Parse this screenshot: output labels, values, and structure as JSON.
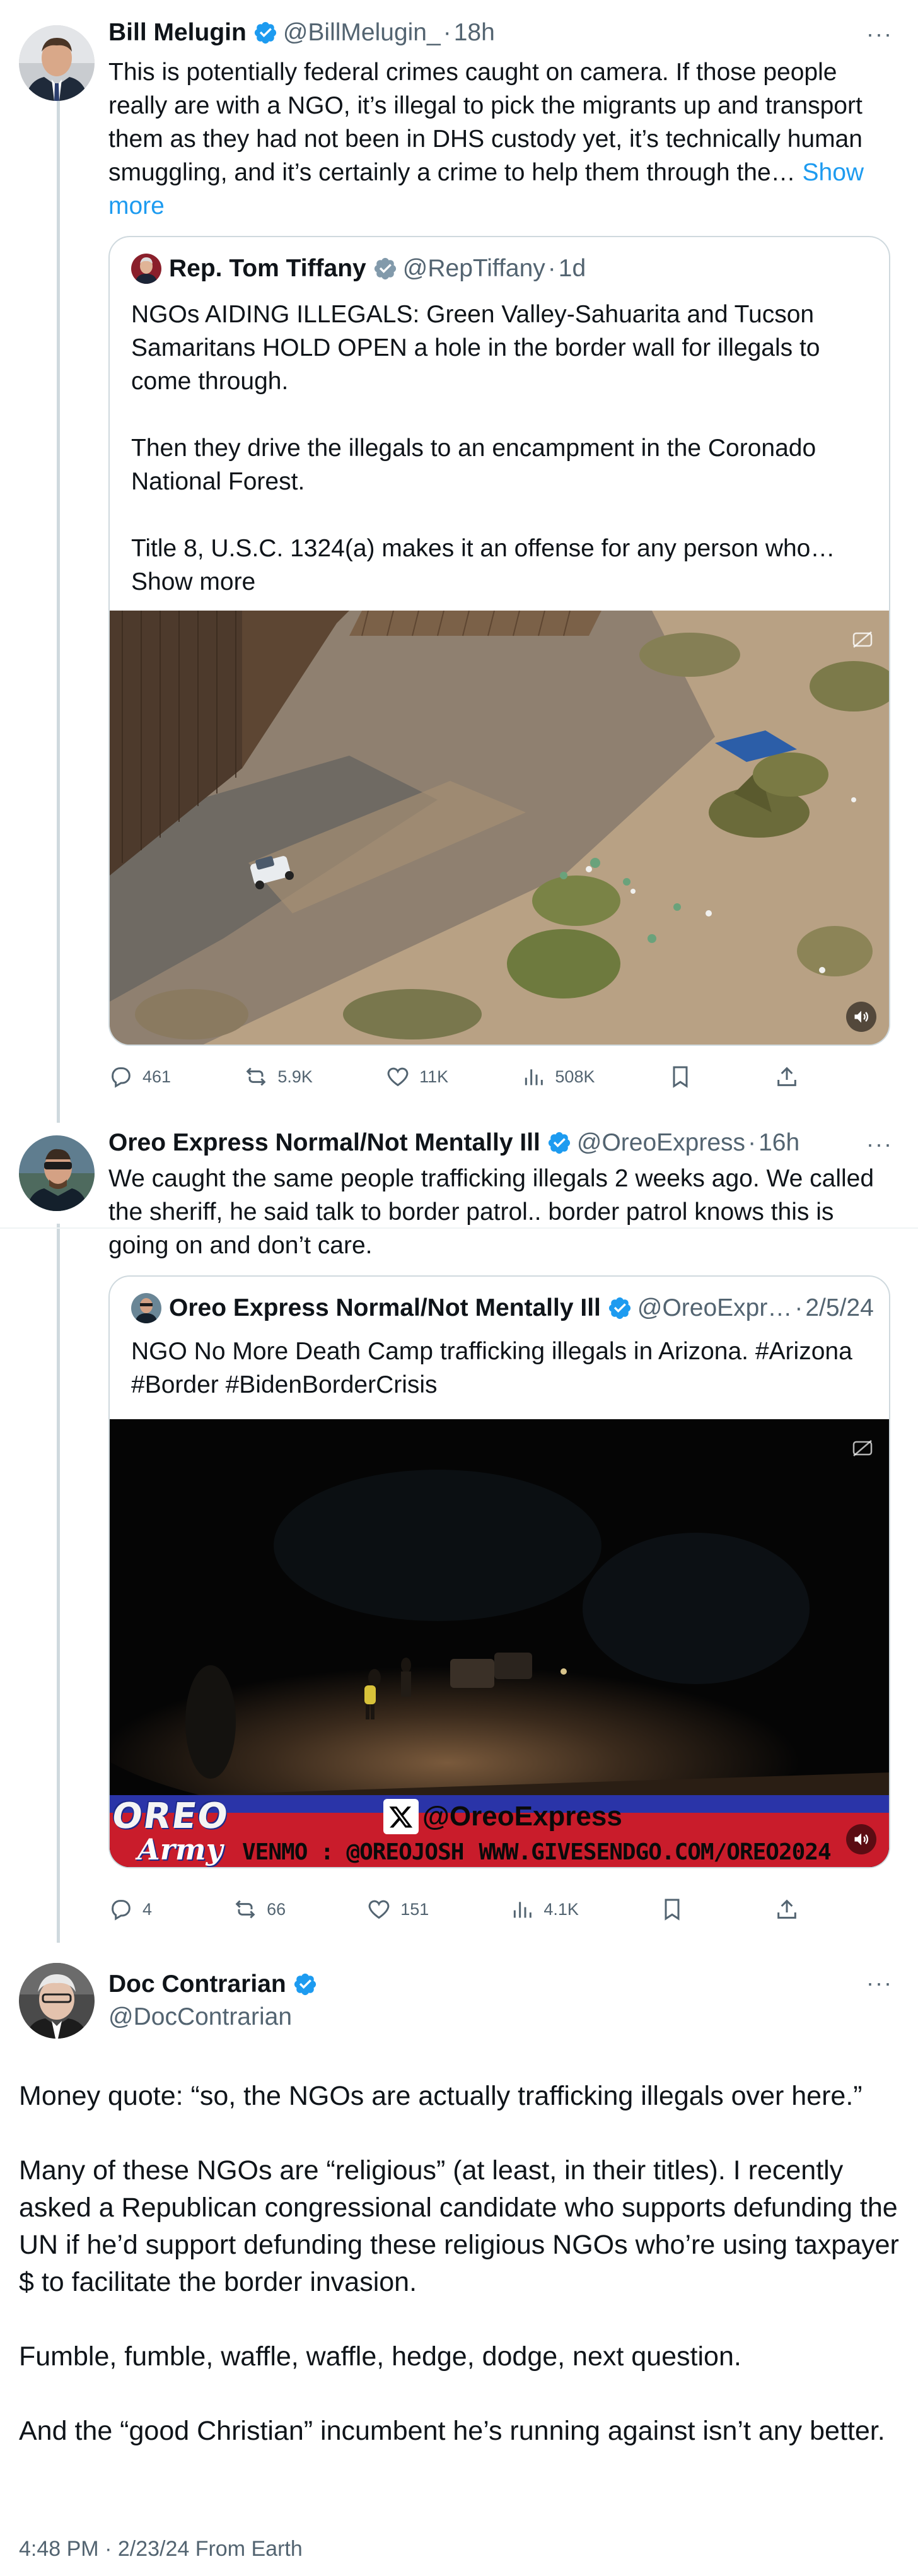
{
  "posts": [
    {
      "author": {
        "name": "Bill Melugin",
        "handle": "@BillMelugin_",
        "time": "18h"
      },
      "text": "This is potentially federal crimes caught on camera. If those people really are with a NGO, it’s illegal to pick the migrants up and transport them as they had not been in DHS custody yet, it’s technically human smuggling, and it’s certainly a crime to help them through the…",
      "show_more": "Show more",
      "quote": {
        "author": {
          "name": "Rep. Tom Tiffany",
          "handle": "@RepTiffany",
          "time": "1d"
        },
        "paragraphs": [
          "NGOs AIDING ILLEGALS: Green Valley-Sahuarita and Tucson Samaritans HOLD OPEN a hole in the border wall for illegals to come through.",
          "Then they drive the illegals to an encampment in the Coronado National Forest.",
          "Title 8, U.S.C. 1324(a) makes it an offense for any person who… Show more"
        ]
      },
      "actions": {
        "replies": "461",
        "reposts": "5.9K",
        "likes": "11K",
        "views": "508K"
      }
    },
    {
      "author": {
        "name": "Oreo Express Normal/Not Mentally Ill",
        "handle": "@OreoExpress",
        "time": "16h"
      },
      "text": "We caught the same people trafficking illegals 2 weeks ago. We called the sheriff, he said talk to border patrol.. border patrol knows this is going on and don’t care.",
      "quote": {
        "author": {
          "name": "Oreo Express Normal/Not Mentally Ill",
          "handle": "@OreoExpr…",
          "time": "2/5/24"
        },
        "text": "NGO No More Death Camp trafficking illegals in Arizona. #Arizona #Border #BidenBorderCrisis",
        "banner": {
          "logo_top": "OREO",
          "logo_bottom": "Army",
          "x_handle": "@OreoExpress",
          "venmo": "VENMO : @OREOJOSH",
          "url": "WWW.GIVESENDGO.COM/OREO2024"
        }
      },
      "actions": {
        "replies": "4",
        "reposts": "66",
        "likes": "151",
        "views": "4.1K"
      }
    }
  ],
  "main_post": {
    "author": {
      "name": "Doc Contrarian",
      "handle": "@DocContrarian"
    },
    "paragraphs": [
      "Money quote: “so, the NGOs are actually trafficking illegals over here.”",
      "Many of these NGOs are “religious” (at least, in their titles). I recently asked a Republican congressional candidate who supports defunding the UN if he’d support defunding these religious NGOs who’re using taxpayer $ to facilitate the border invasion.",
      "Fumble, fumble, waffle, waffle, hedge, dodge, next question.",
      "And the “good Christian” incumbent he’s running against isn’t any better."
    ],
    "timestamp": "4:48 PM · 2/23/24 From Earth"
  },
  "ui": {
    "more_glyph": "···",
    "dot": "·"
  },
  "colors": {
    "accent": "#1d9bf0",
    "secondary": "#536471",
    "border": "#cfd9de"
  }
}
